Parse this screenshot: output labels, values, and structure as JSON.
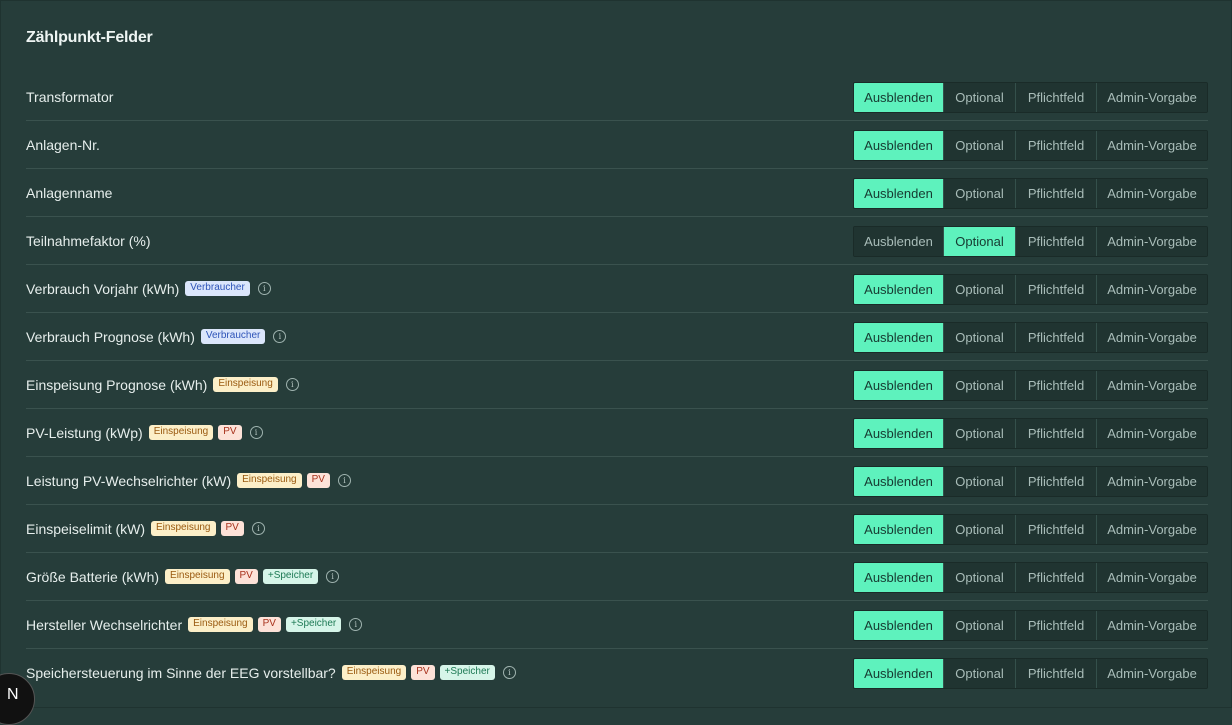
{
  "section_title": "Zählpunkt-Felder",
  "options": [
    "Ausblenden",
    "Optional",
    "Pflichtfeld",
    "Admin-Vorgabe"
  ],
  "colors": {
    "active": "#5ef2bd",
    "background": "#263d3a"
  },
  "badges": {
    "verbraucher": "Verbraucher",
    "einspeisung": "Einspeisung",
    "pv": "PV",
    "speicher": "+Speicher"
  },
  "rows": [
    {
      "label": "Transformator",
      "selected": "Ausblenden"
    },
    {
      "label": "Anlagen-Nr.",
      "selected": "Ausblenden"
    },
    {
      "label": "Anlagenname",
      "selected": "Ausblenden"
    },
    {
      "label": "Teilnahmefaktor (%)",
      "selected": "Optional"
    },
    {
      "label": "Verbrauch Vorjahr (kWh)",
      "selected": "Ausblenden"
    },
    {
      "label": "Verbrauch Prognose (kWh)",
      "selected": "Ausblenden"
    },
    {
      "label": "Einspeisung Prognose (kWh)",
      "selected": "Ausblenden"
    },
    {
      "label": "PV-Leistung (kWp)",
      "selected": "Ausblenden"
    },
    {
      "label": "Leistung PV-Wechselrichter (kW)",
      "selected": "Ausblenden"
    },
    {
      "label": "Einspeiselimit (kW)",
      "selected": "Ausblenden"
    },
    {
      "label": "Größe Batterie (kWh)",
      "selected": "Ausblenden"
    },
    {
      "label": "Hersteller Wechselrichter",
      "selected": "Ausblenden"
    },
    {
      "label": "Speichersteuerung im Sinne der EEG vorstellbar?",
      "selected": "Ausblenden"
    }
  ],
  "dev_badge": "N"
}
